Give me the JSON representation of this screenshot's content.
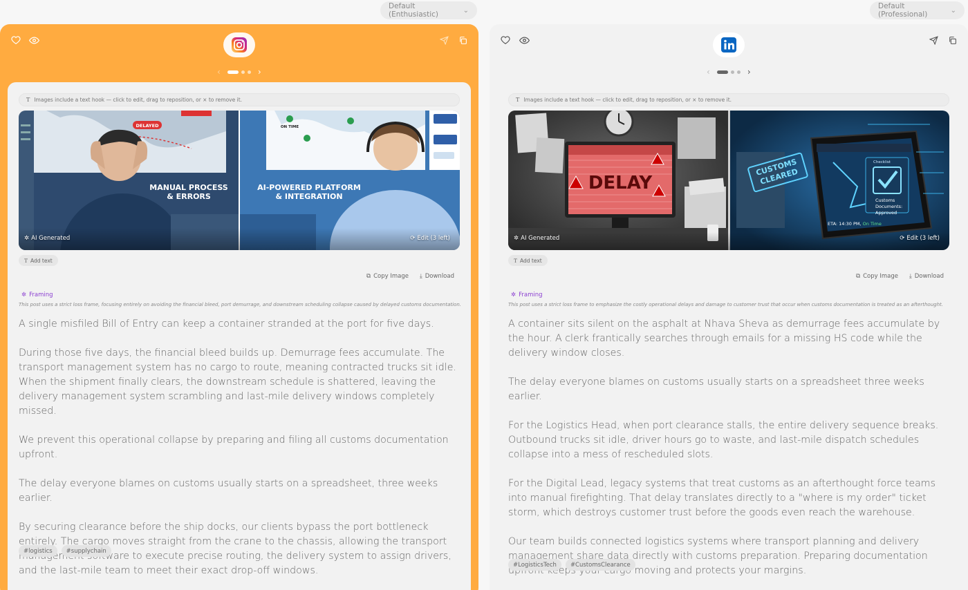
{
  "left": {
    "tone": "Default (Enthusiastic)",
    "platform_icon": "instagram-logo-icon",
    "hook_hint": "Images include a text hook — click to edit, drag to reposition, or × to remove it.",
    "image": {
      "left_caption": "MANUAL PROCESS\n& ERRORS",
      "right_caption": "AI-POWERED PLATFORM\n& INTEGRATION",
      "tag_delayed": "DELAYED",
      "tag_ontime": "ON TIME",
      "ai_badge": "AI Generated",
      "edit_badge": "Edit (3 left)"
    },
    "add_text": "Add text",
    "copy_image": "Copy Image",
    "download": "Download",
    "framing_label": "Framing",
    "framing_desc": "This post uses a strict loss frame, focusing entirely on avoiding the financial bleed, port demurrage, and downstream scheduling collapse caused by delayed customs documentation.",
    "paragraphs": [
      "A single misfiled Bill of Entry can keep a container stranded at the port for five days.",
      "During those five days, the financial bleed builds up. Demurrage fees accumulate. The transport management system has no cargo to route, meaning contracted trucks sit idle. When the shipment finally clears, the downstream schedule is shattered, leaving the delivery management system scrambling and last-mile delivery windows completely missed.",
      "We prevent this operational collapse by preparing and filing all customs documentation upfront.",
      "The delay everyone blames on customs usually starts on a spreadsheet, three weeks earlier.",
      "By securing clearance before the ship docks, our clients bypass the port bottleneck entirely. The cargo moves straight from the crane to the chassis, allowing the transport management software to execute precise routing, the delivery system to assign drivers, and the last-mile team to meet their exact drop-off windows."
    ],
    "tags": [
      "#logistics",
      "#supplychain"
    ]
  },
  "right": {
    "tone": "Default (Professional)",
    "platform_icon": "linkedin-logo-icon",
    "hook_hint": "Images include a text hook — click to edit, drag to reposition, or × to remove it.",
    "image": {
      "delay_text": "DELAY",
      "stamp_text": "CUSTOMS\nCLEARED",
      "checklist_title": "Checklist",
      "checklist_items": [
        "Customs",
        "Documents:",
        "Approved"
      ],
      "eta": "ETA: 14:30 PM,",
      "eta_status": "On Time",
      "ai_badge": "AI Generated",
      "edit_badge": "Edit (3 left)"
    },
    "add_text": "Add text",
    "copy_image": "Copy Image",
    "download": "Download",
    "framing_label": "Framing",
    "framing_desc": "This post uses a strict loss frame to emphasize the costly operational delays and damage to customer trust that occur when customs documentation is treated as an afterthought.",
    "paragraphs": [
      "A container sits silent on the asphalt at Nhava Sheva as demurrage fees accumulate by the hour. A clerk frantically searches through emails for a missing HS code while the delivery window closes.",
      "The delay everyone blames on customs usually starts on a spreadsheet three weeks earlier.",
      "For the Logistics Head, when port clearance stalls, the entire delivery sequence breaks. Outbound trucks sit idle, driver hours go to waste, and last-mile dispatch schedules collapse into a mess of rescheduled slots.",
      "For the Digital Lead, legacy systems that treat customs as an afterthought force teams into manual firefighting. That delay translates directly to a \"where is my order\" ticket storm, which destroys customer trust before the goods even reach the warehouse.",
      "Our team builds connected logistics systems where transport planning and delivery management share data directly with customs preparation. Preparing documentation upfront keeps your cargo moving and protects your margins."
    ],
    "tags": [
      "#LogisticsTech",
      "#CustomsClearance"
    ]
  },
  "colors": {
    "instagram_panel": "#ffab40",
    "framing_accent": "#8b3fd1",
    "linkedin_blue": "#0a66c2"
  }
}
